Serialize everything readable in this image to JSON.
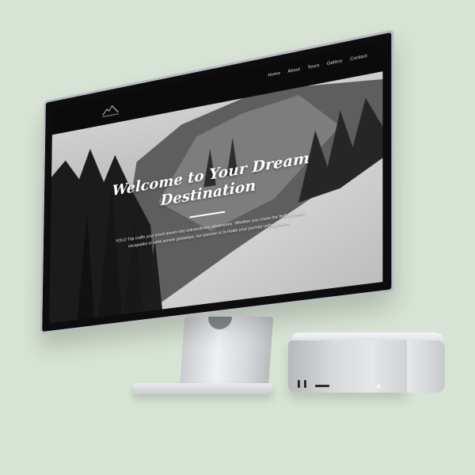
{
  "site": {
    "nav": {
      "items": [
        "Home",
        "About",
        "Tours",
        "Gallery",
        "Contact"
      ]
    },
    "hero": {
      "title_line1": "Welcome to Your Dream",
      "title_line2": "Destination",
      "description": "YOLO Trip crafts your travel dream into extraordinary adventures. Whether you crave the thrill of exotic escapades or seek serene getaways, our passion is to make your journey unforgettable."
    }
  },
  "icons": {
    "logo": "mountain-logo-icon"
  },
  "colors": {
    "background": "#d7e3d4",
    "nav_background": "#0b0b0b",
    "hero_text": "#ffffff"
  }
}
